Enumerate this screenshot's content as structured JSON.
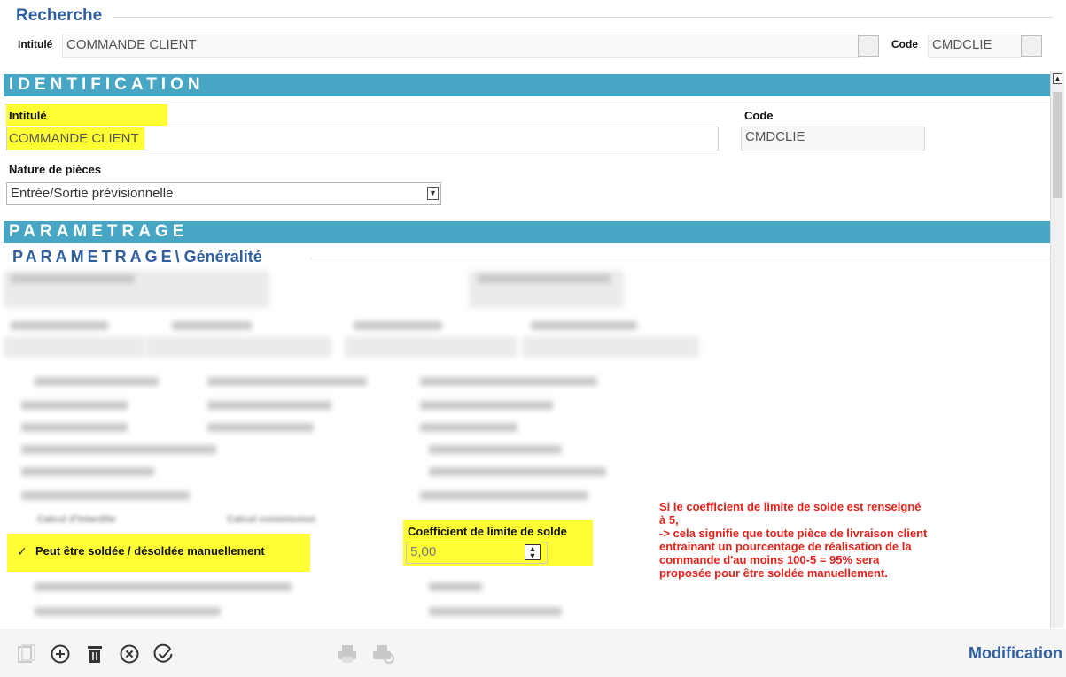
{
  "search": {
    "title": "Recherche",
    "intitule_label": "Intitulé",
    "intitule_value": "COMMANDE CLIENT",
    "code_label": "Code",
    "code_value": "CMDCLIE"
  },
  "identification": {
    "section_title": "IDENTIFICATION",
    "intitule_label": "Intitulé",
    "intitule_value": "COMMANDE CLIENT",
    "code_label": "Code",
    "code_value": "CMDCLIE",
    "nature_label": "Nature de pièces",
    "nature_value": "Entrée/Sortie prévisionnelle"
  },
  "parametrage": {
    "section_title": "PARAMETRAGE",
    "sub_prefix": "PARAMETRAGE",
    "sub_suffix": "\\ Généralité",
    "checkbox_label": "Peut être soldée / désoldée manuellement",
    "coef_label": "Coefficient de limite de solde",
    "coef_value": "5,00",
    "blur_label_1": "Calcul d'interdite",
    "blur_label_2": "Calcul commission"
  },
  "note": {
    "line1": "Si le coefficient de limite de solde est renseigné",
    "line2": "à 5,",
    "line3": "-> cela signifie que toute pièce de livraison client",
    "line4": "entrainant un pourcentage de réalisation de la",
    "line5": "commande d'au moins 100-5 = 95% sera",
    "line6": "proposée pour être soldée manuellement."
  },
  "toolbar": {
    "mode_label": "Modification",
    "icons": [
      "copy-icon",
      "add-icon",
      "delete-icon",
      "cancel-icon",
      "validate-icon",
      "print-icon",
      "print-preview-icon"
    ]
  },
  "colors": {
    "band": "#46a6c3",
    "title_blue": "#2f5f9e",
    "highlight": "#ffff33",
    "note_red": "#e2231a"
  }
}
